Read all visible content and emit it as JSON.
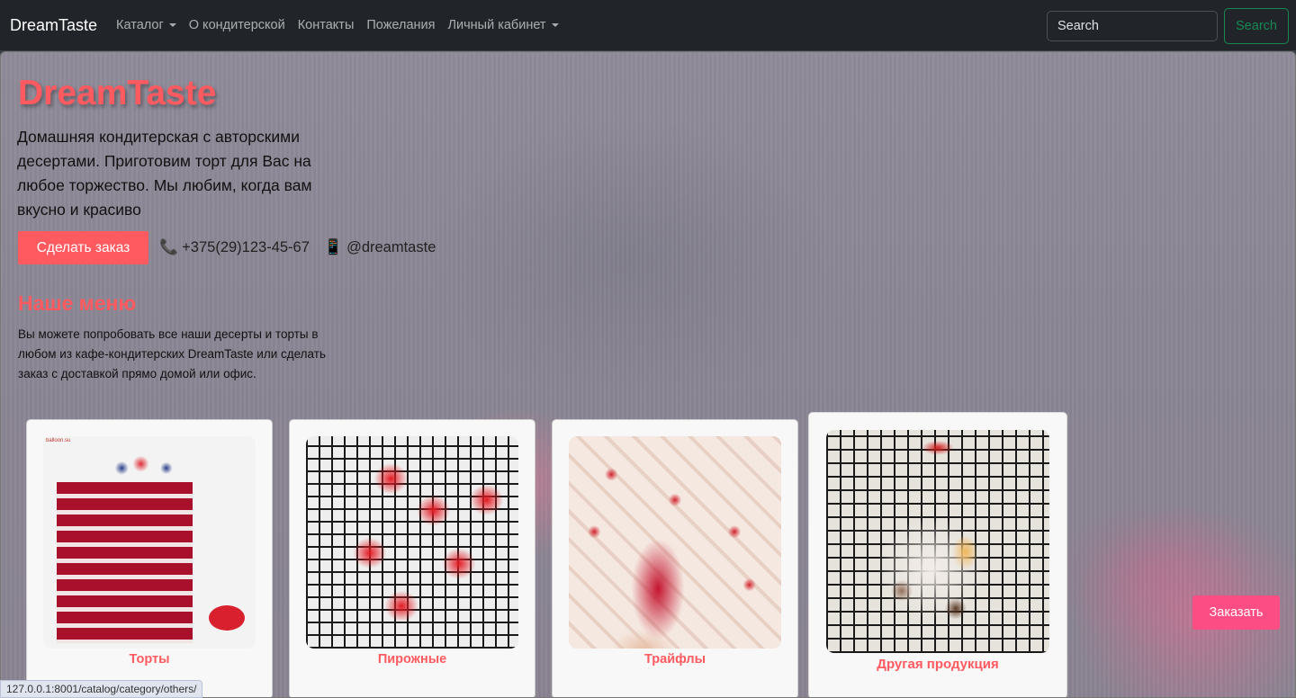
{
  "navbar": {
    "brand": "DreamTaste",
    "links": [
      {
        "label": "Каталог",
        "dropdown": true
      },
      {
        "label": "О кондитерской",
        "dropdown": false
      },
      {
        "label": "Контакты",
        "dropdown": false
      },
      {
        "label": "Пожелания",
        "dropdown": false
      },
      {
        "label": "Личный кабинет",
        "dropdown": true
      }
    ],
    "search_placeholder": "Search",
    "search_button": "Search"
  },
  "hero": {
    "title": "DreamTaste",
    "description": "Домашняя кондитерская с авторскими десертами. Приготовим торт для Вас на любое торжество. Мы любим, когда вам вкусно и красиво",
    "order_button": "Сделать заказ",
    "phone_icon": "📞",
    "phone": "+375(29)123-45-67",
    "social_icon": "📱",
    "social": "@dreamtaste"
  },
  "menu": {
    "title": "Наше меню",
    "description": "Вы можете попробовать все наши десерты и торты в любом из кафе-кондитерских DreamTaste или сделать заказ с доставкой прямо домой или офис.",
    "categories": [
      {
        "label": "Торты",
        "image": "red-velvet-cake-photo",
        "watermark": "balloon.su"
      },
      {
        "label": "Пирожные",
        "image": "red-heart-pastries-photo"
      },
      {
        "label": "Трайфлы",
        "image": "strawberry-trifles-photo"
      },
      {
        "label": "Другая продукция",
        "image": "gift-basket-photo"
      }
    ]
  },
  "floating_order_button": "Заказать",
  "status_url": "127.0.0.1:8001/catalog/category/others/",
  "colors": {
    "navbar_bg": "#212529",
    "accent": "#ff5a60",
    "search_button": "#198754",
    "floating_button": "#fc4e84"
  }
}
